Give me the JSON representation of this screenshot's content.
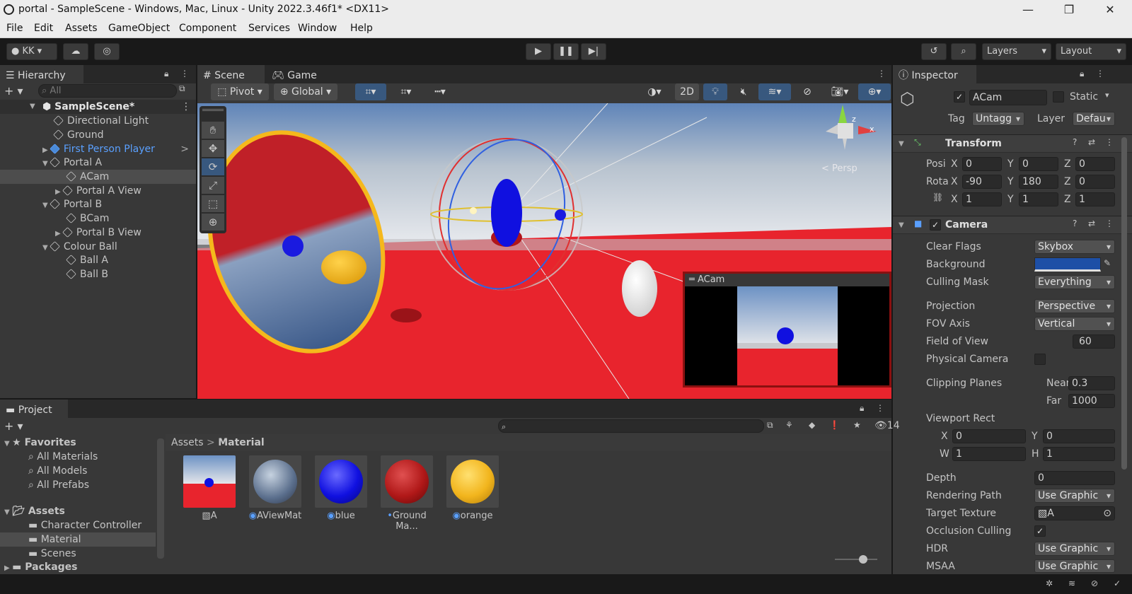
{
  "window": {
    "title": "portal - SampleScene - Windows, Mac, Linux - Unity 2022.3.46f1* <DX11>",
    "minimize": "—",
    "restore": "❐",
    "close": "✕"
  },
  "menu": [
    "File",
    "Edit",
    "Assets",
    "GameObject",
    "Component",
    "Services",
    "Window",
    "Help"
  ],
  "toolbar": {
    "account": "KK",
    "layers": "Layers",
    "layout": "Layout"
  },
  "hierarchy": {
    "tab": "Hierarchy",
    "search_placeholder": "All",
    "scene": "SampleScene*",
    "items": [
      "Directional Light",
      "Ground",
      "First Person Player",
      "Portal A",
      "ACam",
      "Portal A View",
      "Portal B",
      "BCam",
      "Portal B View",
      "Colour Ball",
      "Ball A",
      "Ball B"
    ]
  },
  "scene_view": {
    "tabs": [
      "Scene",
      "Game"
    ],
    "pivot": "Pivot",
    "global": "Global",
    "mode_2d": "2D",
    "gizmo_label": "< Persp",
    "axis_y": "y",
    "axis_x": "x",
    "axis_z": "z",
    "preview_title": "ACam"
  },
  "inspector": {
    "tab": "Inspector",
    "object_name": "ACam",
    "static_label": "Static",
    "tag_label": "Tag",
    "tag_value": "Untagg",
    "layer_label": "Layer",
    "layer_value": "Defau",
    "transform": {
      "title": "Transform",
      "position_label": "Posi",
      "rotation_label": "Rota",
      "pos": [
        "0",
        "0",
        "0"
      ],
      "rot": [
        "-90",
        "180",
        "0"
      ],
      "scale": [
        "1",
        "1",
        "1"
      ],
      "axis": [
        "X",
        "Y",
        "Z"
      ]
    },
    "camera": {
      "title": "Camera",
      "clear_flags_label": "Clear Flags",
      "clear_flags": "Skybox",
      "background_label": "Background",
      "culling_mask_label": "Culling Mask",
      "culling_mask": "Everything",
      "projection_label": "Projection",
      "projection": "Perspective",
      "fov_axis_label": "FOV Axis",
      "fov_axis": "Vertical",
      "fov_label": "Field of View",
      "fov": "60",
      "physical_label": "Physical Camera",
      "clipping_label": "Clipping Planes",
      "near_label": "Near",
      "near": "0.3",
      "far_label": "Far",
      "far": "1000",
      "viewport_label": "Viewport Rect",
      "vp_x_label": "X",
      "vp_x": "0",
      "vp_y_label": "Y",
      "vp_y": "0",
      "vp_w_label": "W",
      "vp_w": "1",
      "vp_h_label": "H",
      "vp_h": "1",
      "depth_label": "Depth",
      "depth": "0",
      "render_path_label": "Rendering Path",
      "render_path": "Use Graphic",
      "target_texture_label": "Target Texture",
      "target_texture": "A",
      "occlusion_label": "Occlusion Culling",
      "hdr_label": "HDR",
      "hdr": "Use Graphic",
      "msaa_label": "MSAA",
      "msaa": "Use Graphic"
    }
  },
  "project": {
    "tab": "Project",
    "favorites": "Favorites",
    "fav_items": [
      "All Materials",
      "All Models",
      "All Prefabs"
    ],
    "assets": "Assets",
    "asset_folders": [
      "Character Controller",
      "Material",
      "Scenes"
    ],
    "packages": "Packages",
    "breadcrumb_root": "Assets",
    "breadcrumb_sep": ">",
    "breadcrumb_current": "Material",
    "hidden_count": "14",
    "files": [
      "A",
      "AViewMat",
      "blue",
      "Ground Ma...",
      "orange"
    ]
  },
  "colors": {
    "ground": "#e8242d",
    "blue": "#1010e0",
    "orange": "#f2b51d",
    "background_swatch": "#1d4fa6"
  }
}
